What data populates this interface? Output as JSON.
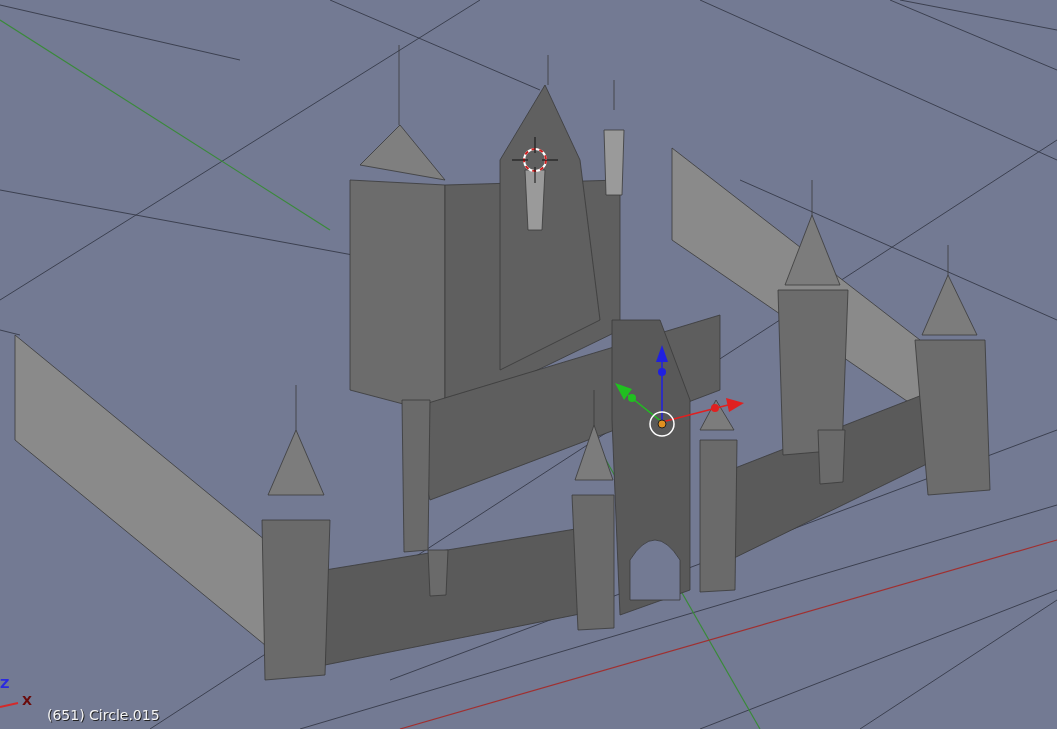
{
  "viewport": {
    "object_info": "(651) Circle.015",
    "axis_labels": [
      {
        "label": "Z",
        "color": "#2a2ae0"
      },
      {
        "label": "X",
        "color": "#6a0a0a"
      }
    ]
  }
}
